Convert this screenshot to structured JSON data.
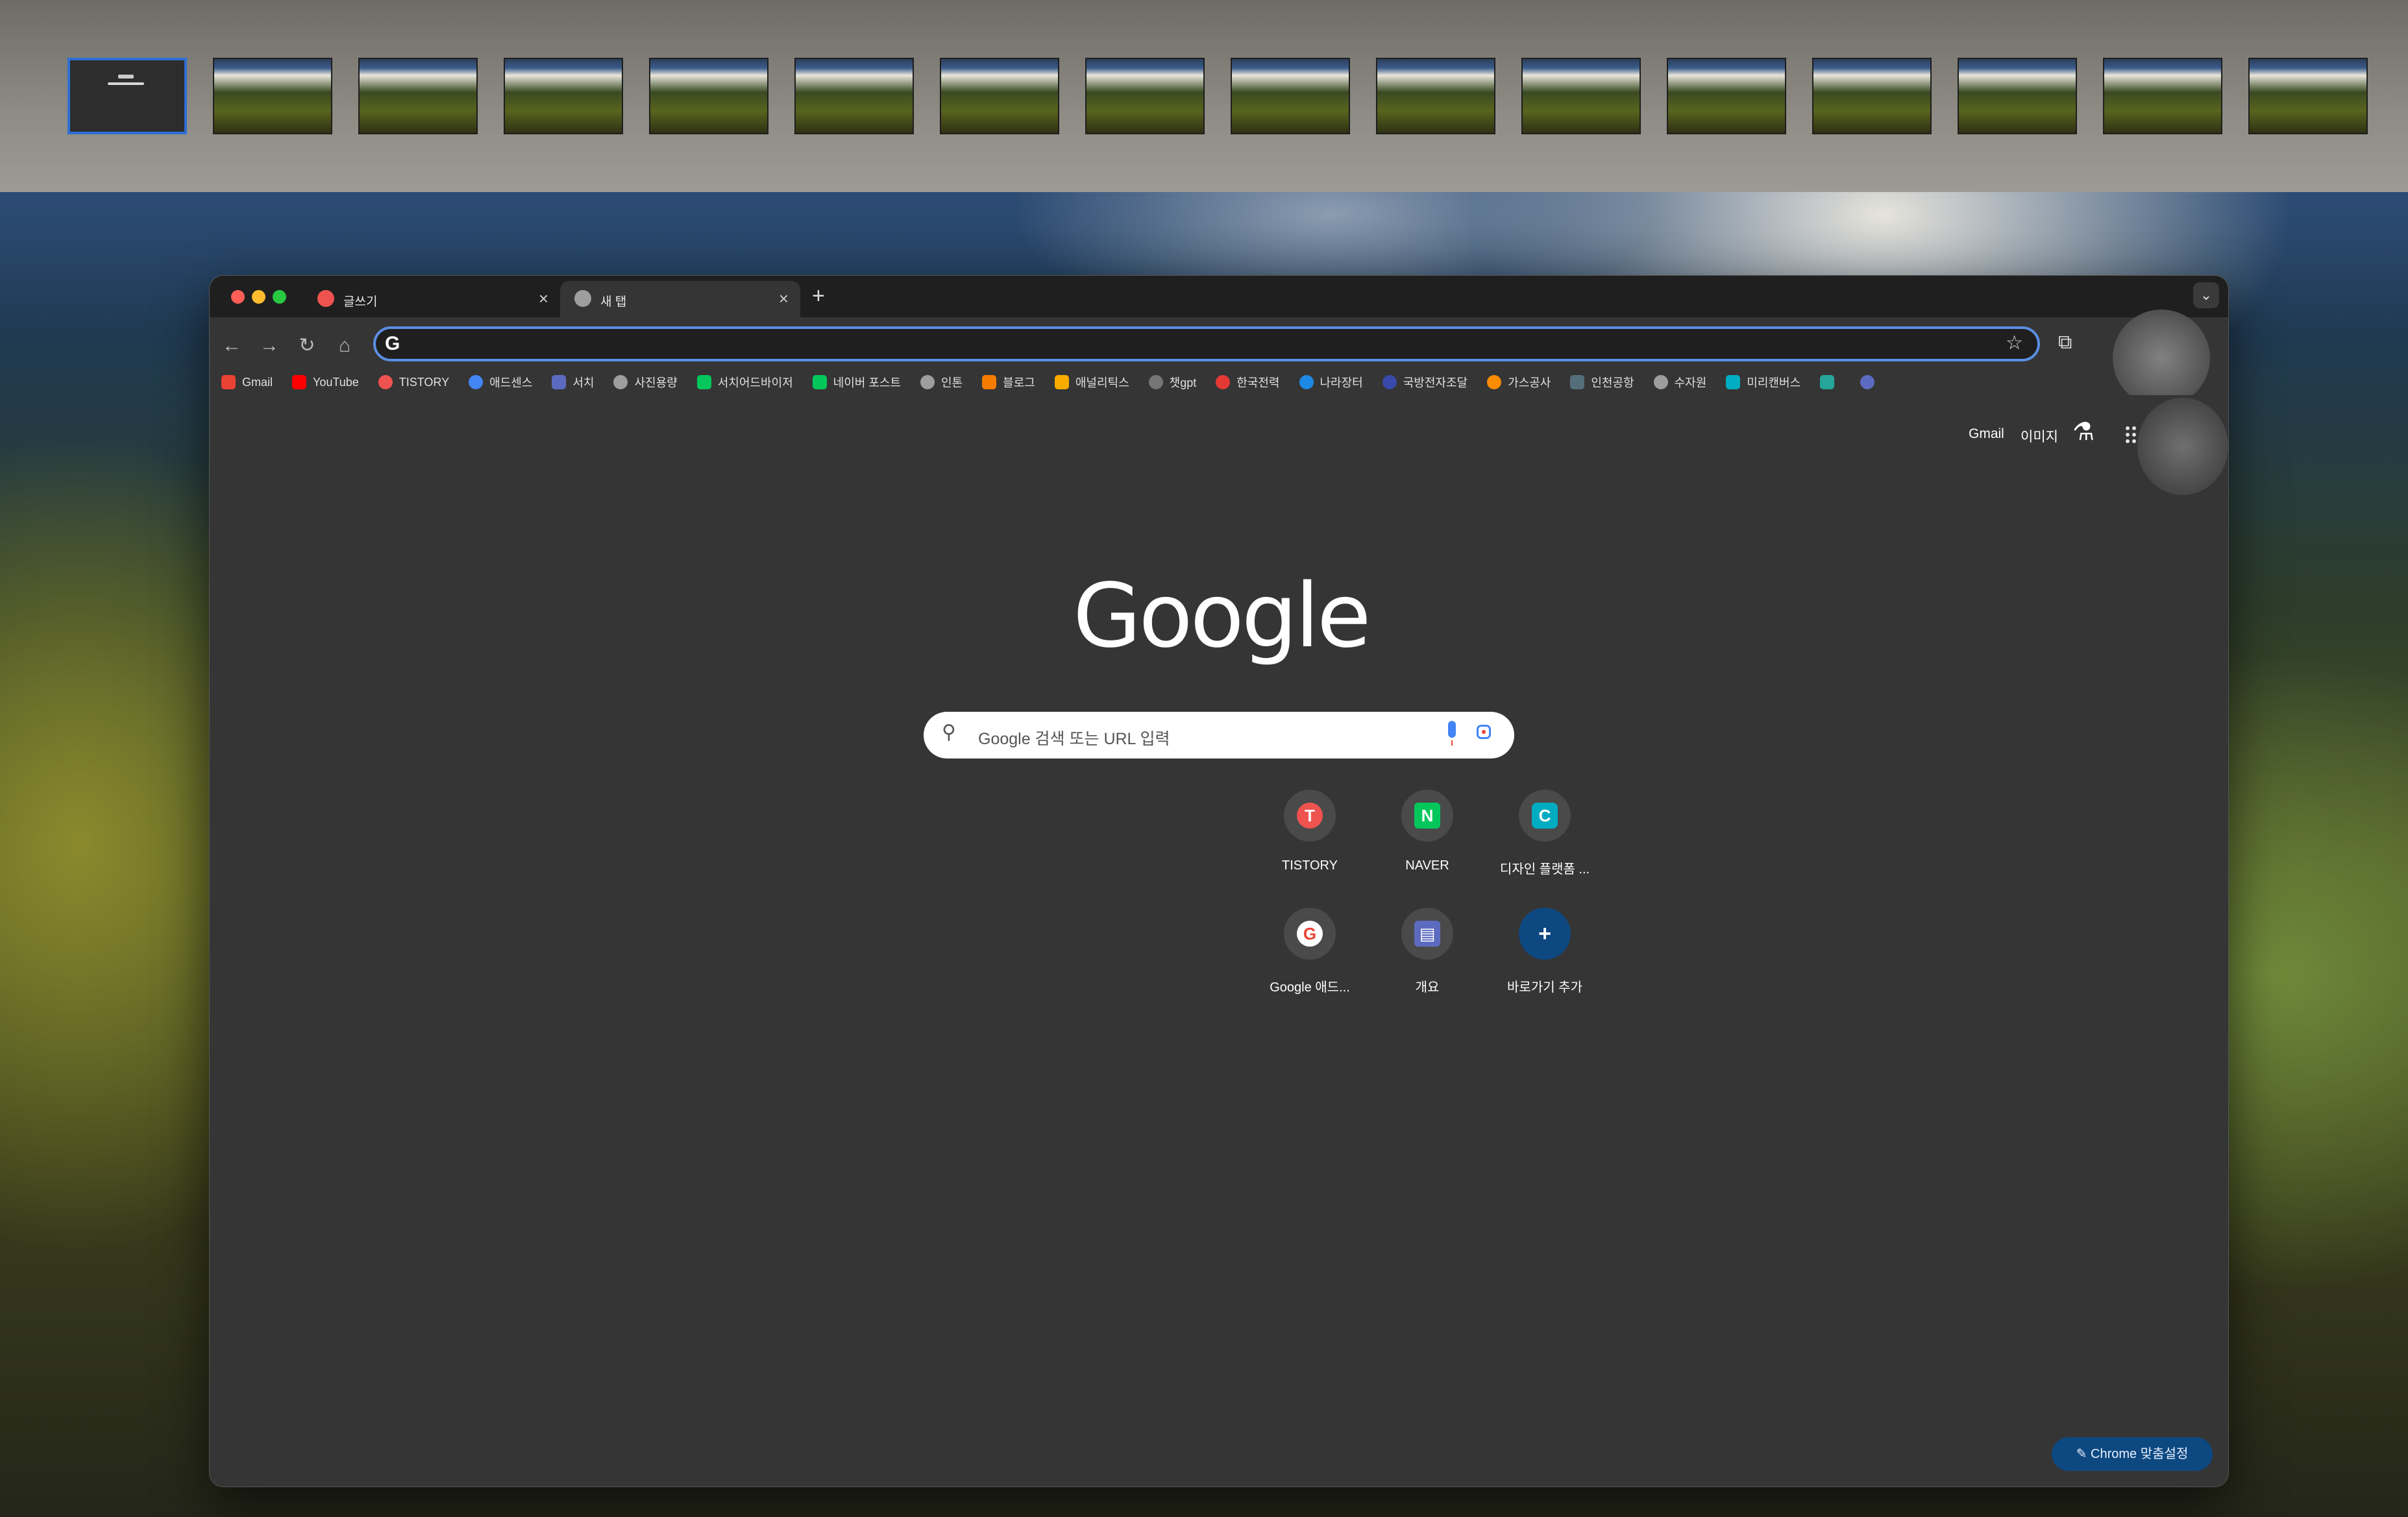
{
  "mission_control": {
    "thumbnail_count": 16,
    "active_index": 0
  },
  "tabs": [
    {
      "title": "글쓰기",
      "favicon_color": "#ef5350",
      "active": false
    },
    {
      "title": "새 탭",
      "favicon_color": "#9e9e9e",
      "active": true
    }
  ],
  "tabbar": {
    "new_tab_label": "+",
    "menu_icon": "chevron-down-icon"
  },
  "toolbar": {
    "back": "←",
    "forward": "→",
    "reload": "↻",
    "home": "⌂",
    "omnibox_value": "",
    "omnibox_prefix": "G",
    "bookmark_star": "☆",
    "extensions": "⧉"
  },
  "bookmarks": [
    {
      "label": "Gmail",
      "color": "#ea4335"
    },
    {
      "label": "YouTube",
      "color": "#ff0000"
    },
    {
      "label": "TISTORY",
      "color": "#ef5350"
    },
    {
      "label": "애드센스",
      "color": "#4285f4"
    },
    {
      "label": "서치",
      "color": "#5c6bc0"
    },
    {
      "label": "사진용량",
      "color": "#9e9e9e"
    },
    {
      "label": "서치어드바이저",
      "color": "#03c75a"
    },
    {
      "label": "네이버 포스트",
      "color": "#03c75a"
    },
    {
      "label": "인톤",
      "color": "#9e9e9e"
    },
    {
      "label": "블로그",
      "color": "#f57c00"
    },
    {
      "label": "애널리틱스",
      "color": "#f9ab00"
    },
    {
      "label": "챗gpt",
      "color": "#757575"
    },
    {
      "label": "한국전력",
      "color": "#e53935"
    },
    {
      "label": "나라장터",
      "color": "#1e88e5"
    },
    {
      "label": "국방전자조달",
      "color": "#3949ab"
    },
    {
      "label": "가스공사",
      "color": "#fb8c00"
    },
    {
      "label": "인천공항",
      "color": "#546e7a"
    },
    {
      "label": "수자원",
      "color": "#9e9e9e"
    },
    {
      "label": "미리캔버스",
      "color": "#00acc1"
    },
    {
      "label": "",
      "color": "#26a69a"
    },
    {
      "label": "",
      "color": "#5c6bc0"
    }
  ],
  "ntp": {
    "gmail_link": "Gmail",
    "images_link": "이미지",
    "logo": "Google",
    "search_placeholder": "Google 검색 또는 URL 입력",
    "shortcuts": [
      {
        "label": "TISTORY",
        "glyph": "T",
        "color": "#ef5350"
      },
      {
        "label": "NAVER",
        "glyph": "N",
        "color": "#03c75a"
      },
      {
        "label": "디자인 플랫폼 ...",
        "glyph": "C",
        "color": "#00acc1"
      },
      {
        "label": "Google 애드...",
        "glyph": "G",
        "color": "#ffffff"
      },
      {
        "label": "개요",
        "glyph": "▤",
        "color": "#5c6bc0"
      },
      {
        "label": "바로가기 추가",
        "glyph": "+",
        "color": "#0e4880"
      }
    ],
    "customize_label": "Chrome 맞춤설정"
  }
}
